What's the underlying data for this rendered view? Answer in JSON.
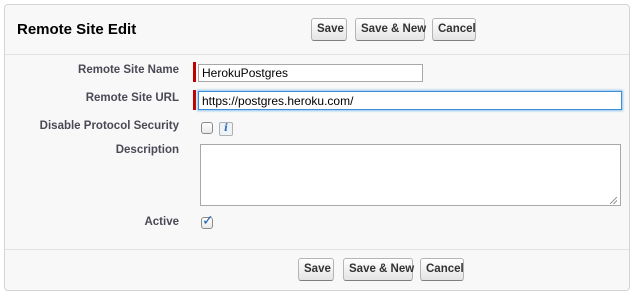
{
  "header": {
    "title": "Remote Site Edit",
    "save_label": "Save",
    "save_new_label": "Save & New",
    "cancel_label": "Cancel"
  },
  "form": {
    "remote_site_name": {
      "label": "Remote Site Name",
      "value": "HerokuPostgres",
      "required": true
    },
    "remote_site_url": {
      "label": "Remote Site URL",
      "value": "https://postgres.heroku.com/",
      "required": true
    },
    "disable_protocol_security": {
      "label": "Disable Protocol Security",
      "checked": false,
      "info_icon": "i"
    },
    "description": {
      "label": "Description",
      "value": ""
    },
    "active": {
      "label": "Active",
      "checked": true
    }
  },
  "footer": {
    "save_label": "Save",
    "save_new_label": "Save & New",
    "cancel_label": "Cancel"
  },
  "colors": {
    "required_marker": "#c00000",
    "focus_border": "#3a8fd8",
    "check": "#1e5fb4"
  }
}
